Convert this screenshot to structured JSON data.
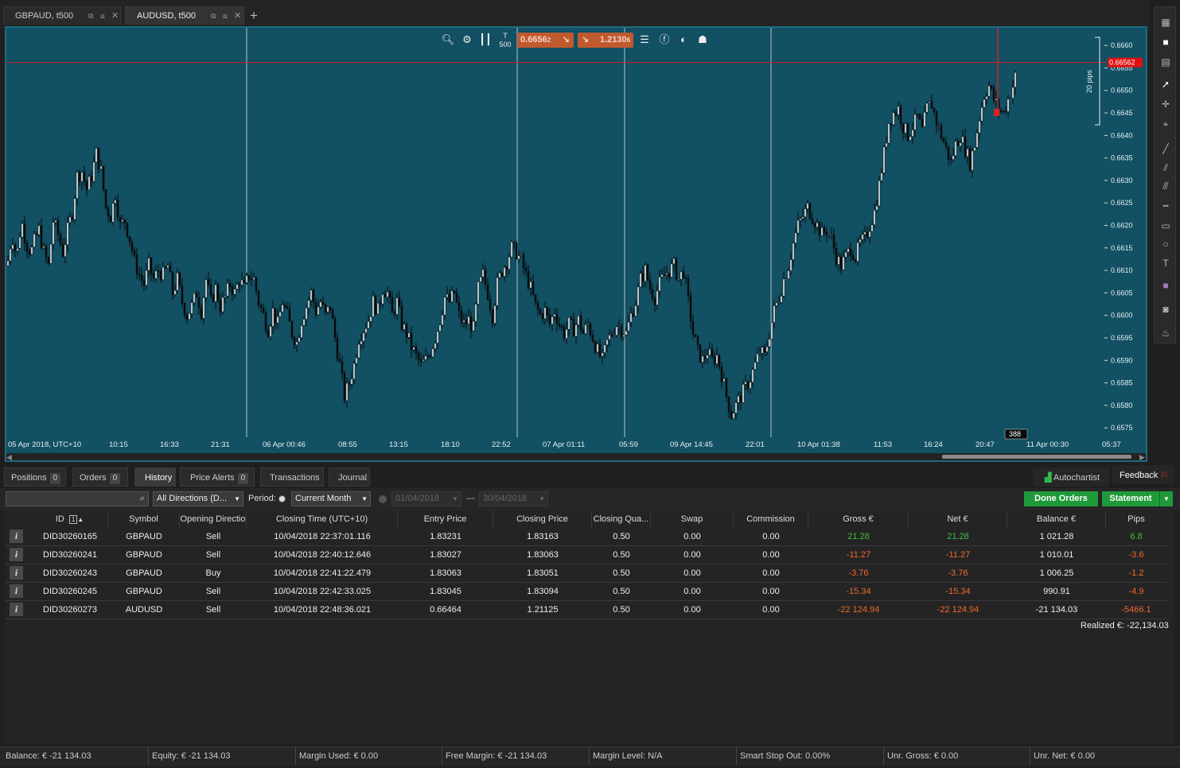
{
  "tabs": [
    {
      "label": "GBPAUD, t500",
      "active": false
    },
    {
      "label": "AUDUSD, t500",
      "active": true
    }
  ],
  "chart": {
    "sell_price": "0.6656",
    "sell_price_small": "2",
    "buy_price": "1.2130",
    "buy_price_small": "6",
    "tick_label": "500",
    "current_price_label": "0.66562",
    "pips_label": "20 pips",
    "cursor_label": "388",
    "colors": {
      "background": "#125063",
      "candle": "#0a0a0a",
      "price_line": "#cc2222",
      "sell_button": "#c1592f"
    }
  },
  "chart_data": {
    "type": "candlestick",
    "y_ticks": [
      "0.6660",
      "0.6655",
      "0.6650",
      "0.6645",
      "0.6640",
      "0.6635",
      "0.6630",
      "0.6625",
      "0.6620",
      "0.6615",
      "0.6610",
      "0.6605",
      "0.6600",
      "0.6595",
      "0.6590",
      "0.6585",
      "0.6580",
      "0.6575"
    ],
    "x_ticks": [
      "05 Apr 2018, UTC+10",
      "10:15",
      "16:33",
      "21:31",
      "06 Apr 00:46",
      "08:55",
      "13:15",
      "18:10",
      "22:52",
      "07 Apr 01:11",
      "05:59",
      "09 Apr 14:45",
      "22:01",
      "10 Apr 01:38",
      "11:53",
      "16:24",
      "20:47",
      "11 Apr 00:30",
      "05:37"
    ],
    "ylim": [
      0.65745,
      0.66625
    ],
    "current_price": 0.66562,
    "close_path": [
      [
        0,
        0.6611
      ],
      [
        6,
        0.6618
      ],
      [
        12,
        0.6613
      ],
      [
        18,
        0.6621
      ],
      [
        24,
        0.6616
      ],
      [
        30,
        0.6614
      ],
      [
        35,
        0.6617
      ],
      [
        40,
        0.6619
      ],
      [
        46,
        0.6614
      ],
      [
        52,
        0.6611
      ],
      [
        58,
        0.6621
      ],
      [
        64,
        0.6618
      ],
      [
        70,
        0.6614
      ],
      [
        76,
        0.6619
      ],
      [
        82,
        0.6623
      ],
      [
        88,
        0.6631
      ],
      [
        94,
        0.6632
      ],
      [
        100,
        0.6628
      ],
      [
        106,
        0.6631
      ],
      [
        112,
        0.6636
      ],
      [
        118,
        0.6632
      ],
      [
        124,
        0.6624
      ],
      [
        130,
        0.6622
      ],
      [
        136,
        0.6627
      ],
      [
        142,
        0.662
      ],
      [
        148,
        0.6621
      ],
      [
        154,
        0.6617
      ],
      [
        160,
        0.6612
      ],
      [
        166,
        0.6609
      ],
      [
        172,
        0.6607
      ],
      [
        178,
        0.6611
      ],
      [
        184,
        0.6608
      ],
      [
        190,
        0.661
      ],
      [
        196,
        0.6609
      ],
      [
        202,
        0.6611
      ],
      [
        208,
        0.6605
      ],
      [
        214,
        0.6608
      ],
      [
        220,
        0.6603
      ],
      [
        226,
        0.66
      ],
      [
        232,
        0.6602
      ],
      [
        238,
        0.6605
      ],
      [
        244,
        0.6601
      ],
      [
        250,
        0.6608
      ],
      [
        256,
        0.6603
      ],
      [
        262,
        0.6606
      ],
      [
        268,
        0.6602
      ],
      [
        274,
        0.6604
      ],
      [
        280,
        0.6607
      ],
      [
        286,
        0.6605
      ],
      [
        292,
        0.6608
      ],
      [
        298,
        0.6606
      ],
      [
        304,
        0.6609
      ],
      [
        310,
        0.6608
      ],
      [
        316,
        0.6603
      ],
      [
        322,
        0.66
      ],
      [
        328,
        0.6597
      ],
      [
        334,
        0.6601
      ],
      [
        340,
        0.6598
      ],
      [
        346,
        0.6603
      ],
      [
        352,
        0.66
      ],
      [
        358,
        0.6596
      ],
      [
        364,
        0.6594
      ],
      [
        370,
        0.6599
      ],
      [
        376,
        0.6602
      ],
      [
        382,
        0.6605
      ],
      [
        388,
        0.6601
      ],
      [
        394,
        0.6603
      ],
      [
        400,
        0.66
      ],
      [
        406,
        0.6602
      ],
      [
        412,
        0.6595
      ],
      [
        418,
        0.6589
      ],
      [
        424,
        0.6582
      ],
      [
        430,
        0.6585
      ],
      [
        436,
        0.6589
      ],
      [
        442,
        0.6595
      ],
      [
        448,
        0.6597
      ],
      [
        454,
        0.6599
      ],
      [
        460,
        0.6603
      ],
      [
        466,
        0.6601
      ],
      [
        472,
        0.6606
      ],
      [
        478,
        0.6605
      ],
      [
        484,
        0.66
      ],
      [
        490,
        0.6603
      ],
      [
        496,
        0.6598
      ],
      [
        502,
        0.6596
      ],
      [
        508,
        0.6593
      ],
      [
        514,
        0.6591
      ],
      [
        520,
        0.6589
      ],
      [
        526,
        0.659
      ],
      [
        532,
        0.6592
      ],
      [
        538,
        0.6595
      ],
      [
        544,
        0.6599
      ],
      [
        550,
        0.6604
      ],
      [
        556,
        0.6603
      ],
      [
        562,
        0.6605
      ],
      [
        568,
        0.66
      ],
      [
        574,
        0.6598
      ],
      [
        580,
        0.6599
      ],
      [
        586,
        0.6597
      ],
      [
        592,
        0.6606
      ],
      [
        598,
        0.6609
      ],
      [
        604,
        0.6605
      ],
      [
        610,
        0.66
      ],
      [
        616,
        0.6607
      ],
      [
        622,
        0.661
      ],
      [
        628,
        0.6612
      ],
      [
        634,
        0.6615
      ],
      [
        640,
        0.6614
      ],
      [
        646,
        0.6612
      ],
      [
        652,
        0.6609
      ],
      [
        658,
        0.6606
      ],
      [
        664,
        0.6602
      ],
      [
        670,
        0.66
      ],
      [
        676,
        0.6601
      ],
      [
        682,
        0.6598
      ],
      [
        688,
        0.6601
      ],
      [
        694,
        0.6598
      ],
      [
        700,
        0.6596
      ],
      [
        706,
        0.6598
      ],
      [
        712,
        0.6597
      ],
      [
        718,
        0.6599
      ],
      [
        724,
        0.6596
      ],
      [
        730,
        0.6598
      ],
      [
        736,
        0.6595
      ],
      [
        742,
        0.6592
      ],
      [
        748,
        0.659
      ],
      [
        754,
        0.6594
      ],
      [
        760,
        0.6596
      ],
      [
        766,
        0.6598
      ],
      [
        772,
        0.6597
      ],
      [
        778,
        0.6596
      ],
      [
        784,
        0.66
      ],
      [
        790,
        0.6603
      ],
      [
        796,
        0.6608
      ],
      [
        802,
        0.661
      ],
      [
        808,
        0.6606
      ],
      [
        814,
        0.6604
      ],
      [
        820,
        0.6607
      ],
      [
        826,
        0.6609
      ],
      [
        832,
        0.661
      ],
      [
        838,
        0.6611
      ],
      [
        844,
        0.6608
      ],
      [
        850,
        0.661
      ],
      [
        856,
        0.6603
      ],
      [
        862,
        0.6596
      ],
      [
        868,
        0.6592
      ],
      [
        874,
        0.659
      ],
      [
        880,
        0.6592
      ],
      [
        886,
        0.659
      ],
      [
        892,
        0.6591
      ],
      [
        898,
        0.6587
      ],
      [
        904,
        0.6582
      ],
      [
        910,
        0.6578
      ],
      [
        916,
        0.658
      ],
      [
        922,
        0.6582
      ],
      [
        928,
        0.6584
      ],
      [
        934,
        0.6586
      ],
      [
        940,
        0.6589
      ],
      [
        946,
        0.6592
      ],
      [
        952,
        0.6591
      ],
      [
        958,
        0.6596
      ],
      [
        964,
        0.6601
      ],
      [
        970,
        0.6604
      ],
      [
        976,
        0.6608
      ],
      [
        982,
        0.6611
      ],
      [
        988,
        0.6616
      ],
      [
        994,
        0.662
      ],
      [
        1000,
        0.6622
      ],
      [
        1006,
        0.6624
      ],
      [
        1012,
        0.6622
      ],
      [
        1018,
        0.662
      ],
      [
        1024,
        0.6618
      ],
      [
        1030,
        0.6619
      ],
      [
        1036,
        0.6617
      ],
      [
        1042,
        0.6613
      ],
      [
        1048,
        0.6611
      ],
      [
        1054,
        0.6613
      ],
      [
        1060,
        0.6615
      ],
      [
        1066,
        0.6613
      ],
      [
        1072,
        0.6616
      ],
      [
        1078,
        0.6617
      ],
      [
        1084,
        0.662
      ],
      [
        1090,
        0.6623
      ],
      [
        1096,
        0.6629
      ],
      [
        1102,
        0.6636
      ],
      [
        1108,
        0.6643
      ],
      [
        1114,
        0.6645
      ],
      [
        1120,
        0.6646
      ],
      [
        1126,
        0.6642
      ],
      [
        1132,
        0.664
      ],
      [
        1138,
        0.6642
      ],
      [
        1144,
        0.6644
      ],
      [
        1150,
        0.6641
      ],
      [
        1156,
        0.6646
      ],
      [
        1162,
        0.6647
      ],
      [
        1168,
        0.6643
      ],
      [
        1174,
        0.664
      ],
      [
        1180,
        0.6637
      ],
      [
        1186,
        0.6634
      ],
      [
        1192,
        0.6638
      ],
      [
        1198,
        0.664
      ],
      [
        1204,
        0.6637
      ],
      [
        1210,
        0.6634
      ],
      [
        1216,
        0.6638
      ],
      [
        1222,
        0.6644
      ],
      [
        1228,
        0.6649
      ],
      [
        1234,
        0.6651
      ],
      [
        1240,
        0.6648
      ],
      [
        1246,
        0.6646
      ],
      [
        1252,
        0.6645
      ],
      [
        1258,
        0.6648
      ],
      [
        1264,
        0.6651
      ],
      [
        1270,
        0.6655
      ],
      [
        1276,
        0.6656
      ]
    ]
  },
  "right_toolbar": {
    "icons": [
      "layout-grid-icon",
      "single-window-icon",
      "split-window-icon",
      "cursor-icon",
      "crosshair-icon",
      "zoom-icon",
      "line-icon",
      "fibonacci-icon",
      "channel-icon",
      "hline-icon",
      "rectangle-icon",
      "ellipse-icon",
      "text-icon",
      "color-swatch-icon",
      "camera-icon",
      "alert-bell-icon"
    ]
  },
  "bottom_tabs": [
    {
      "label": "Positions",
      "count": "0"
    },
    {
      "label": "Orders",
      "count": "0"
    },
    {
      "label": "History",
      "count": null,
      "active": true
    },
    {
      "label": "Price Alerts",
      "count": "0"
    },
    {
      "label": "Transactions",
      "count": null
    },
    {
      "label": "Journal",
      "count": null
    }
  ],
  "autochartist_label": "Autochartist",
  "feedback_label": "Feedback",
  "filters": {
    "search_value": "",
    "direction": "All Directions (D...",
    "period_label": "Period:",
    "period_value": "Current Month",
    "date_from": "01/04/2018",
    "date_sep": "—",
    "date_to": "30/04/2018",
    "done_orders": "Done Orders",
    "statement": "Statement"
  },
  "table": {
    "headers": [
      "ID",
      "Symbol",
      "Opening Directio",
      "Closing Time (UTC+10)",
      "Entry Price",
      "Closing Price",
      "Closing Qua...",
      "Swap",
      "Commission",
      "Gross €",
      "Net €",
      "Balance €",
      "Pips"
    ],
    "sort_index": "1",
    "rows": [
      {
        "id": "DID30260165",
        "symbol": "GBPAUD",
        "dir": "Sell",
        "time": "10/04/2018 22:37:01.116",
        "entry": "1.83231",
        "close": "1.83163",
        "qty": "0.50",
        "swap": "0.00",
        "comm": "0.00",
        "gross": "21.28",
        "net": "21.28",
        "balance": "1 021.28",
        "pips": "6.8",
        "pos": true
      },
      {
        "id": "DID30260241",
        "symbol": "GBPAUD",
        "dir": "Sell",
        "time": "10/04/2018 22:40:12.646",
        "entry": "1.83027",
        "close": "1.83063",
        "qty": "0.50",
        "swap": "0.00",
        "comm": "0.00",
        "gross": "-11.27",
        "net": "-11.27",
        "balance": "1 010.01",
        "pips": "-3.6",
        "pos": false
      },
      {
        "id": "DID30260243",
        "symbol": "GBPAUD",
        "dir": "Buy",
        "time": "10/04/2018 22:41:22.479",
        "entry": "1.83063",
        "close": "1.83051",
        "qty": "0.50",
        "swap": "0.00",
        "comm": "0.00",
        "gross": "-3.76",
        "net": "-3.76",
        "balance": "1 006.25",
        "pips": "-1.2",
        "pos": false
      },
      {
        "id": "DID30260245",
        "symbol": "GBPAUD",
        "dir": "Sell",
        "time": "10/04/2018 22:42:33.025",
        "entry": "1.83045",
        "close": "1.83094",
        "qty": "0.50",
        "swap": "0.00",
        "comm": "0.00",
        "gross": "-15.34",
        "net": "-15.34",
        "balance": "990.91",
        "pips": "-4.9",
        "pos": false
      },
      {
        "id": "DID30260273",
        "symbol": "AUDUSD",
        "dir": "Sell",
        "time": "10/04/2018 22:48:36.021",
        "entry": "0.66464",
        "close": "1.21125",
        "qty": "0.50",
        "swap": "0.00",
        "comm": "0.00",
        "gross": "-22 124.94",
        "net": "-22 124.94",
        "balance": "-21 134.03",
        "pips": "-5466.1",
        "pos": false
      }
    ],
    "realized_label": "Realized €:",
    "realized_value": "-22,134.03"
  },
  "status": [
    {
      "label": "Balance:",
      "value": "€ -21 134.03"
    },
    {
      "label": "Equity:",
      "value": "€ -21 134.03"
    },
    {
      "label": "Margin Used:",
      "value": "€ 0.00"
    },
    {
      "label": "Free Margin:",
      "value": "€ -21 134.03"
    },
    {
      "label": "Margin Level:",
      "value": "N/A"
    },
    {
      "label": "Smart Stop Out:",
      "value": "0.00%"
    },
    {
      "label": "Unr. Gross:",
      "value": "€ 0.00"
    },
    {
      "label": "Unr. Net:",
      "value": "€ 0.00"
    }
  ]
}
